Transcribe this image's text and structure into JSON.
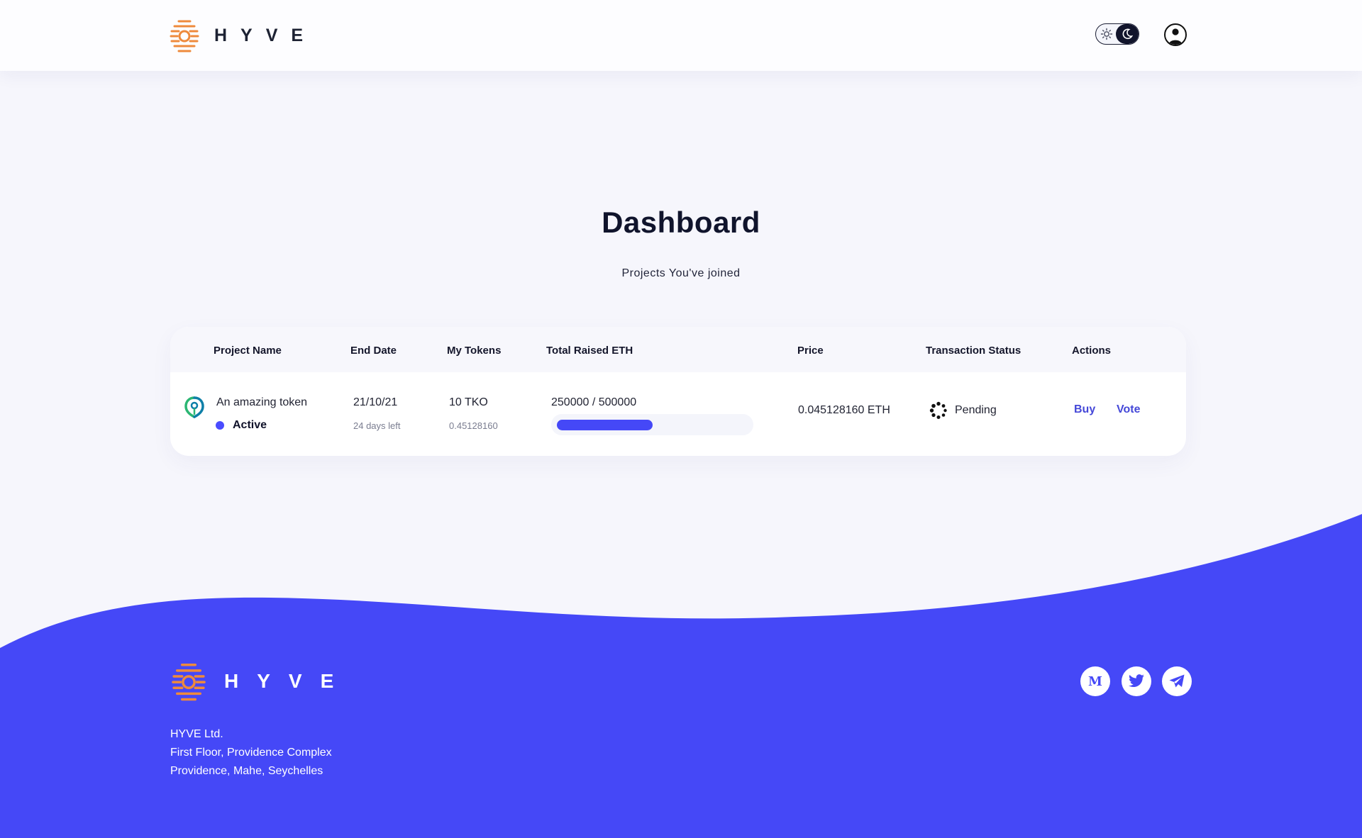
{
  "header": {
    "brand": "HYVE",
    "theme_toggle": {
      "mode": "dark"
    }
  },
  "main": {
    "title": "Dashboard",
    "subtitle": "Projects You've joined"
  },
  "table": {
    "columns": [
      "Project Name",
      "End Date",
      "My Tokens",
      "Total Raised ETH",
      "Price",
      "Transaction Status",
      "Actions"
    ],
    "rows": [
      {
        "project_name": "An amazing token",
        "status": "Active",
        "end_date": "21/10/21",
        "days_left": "24 days left",
        "tokens": "10 TKO",
        "tokens_value": "0.45128160",
        "raised": "250000 / 500000",
        "raised_fraction": 0.5,
        "price": "0.045128160 ETH",
        "transaction_status": "Pending",
        "actions": {
          "buy": "Buy",
          "vote": "Vote"
        }
      }
    ]
  },
  "footer": {
    "brand": "HYVE",
    "address": [
      "HYVE Ltd.",
      "First Floor, Providence Complex",
      "Providence, Mahe, Seychelles"
    ],
    "social": [
      {
        "name": "medium-icon",
        "glyph": "M"
      },
      {
        "name": "twitter-icon"
      },
      {
        "name": "telegram-icon"
      }
    ]
  },
  "colors": {
    "accent": "#4548f7",
    "brand_orange": "#ee8a3c",
    "background": "#f6f6fc",
    "text_dark": "#10142c"
  }
}
